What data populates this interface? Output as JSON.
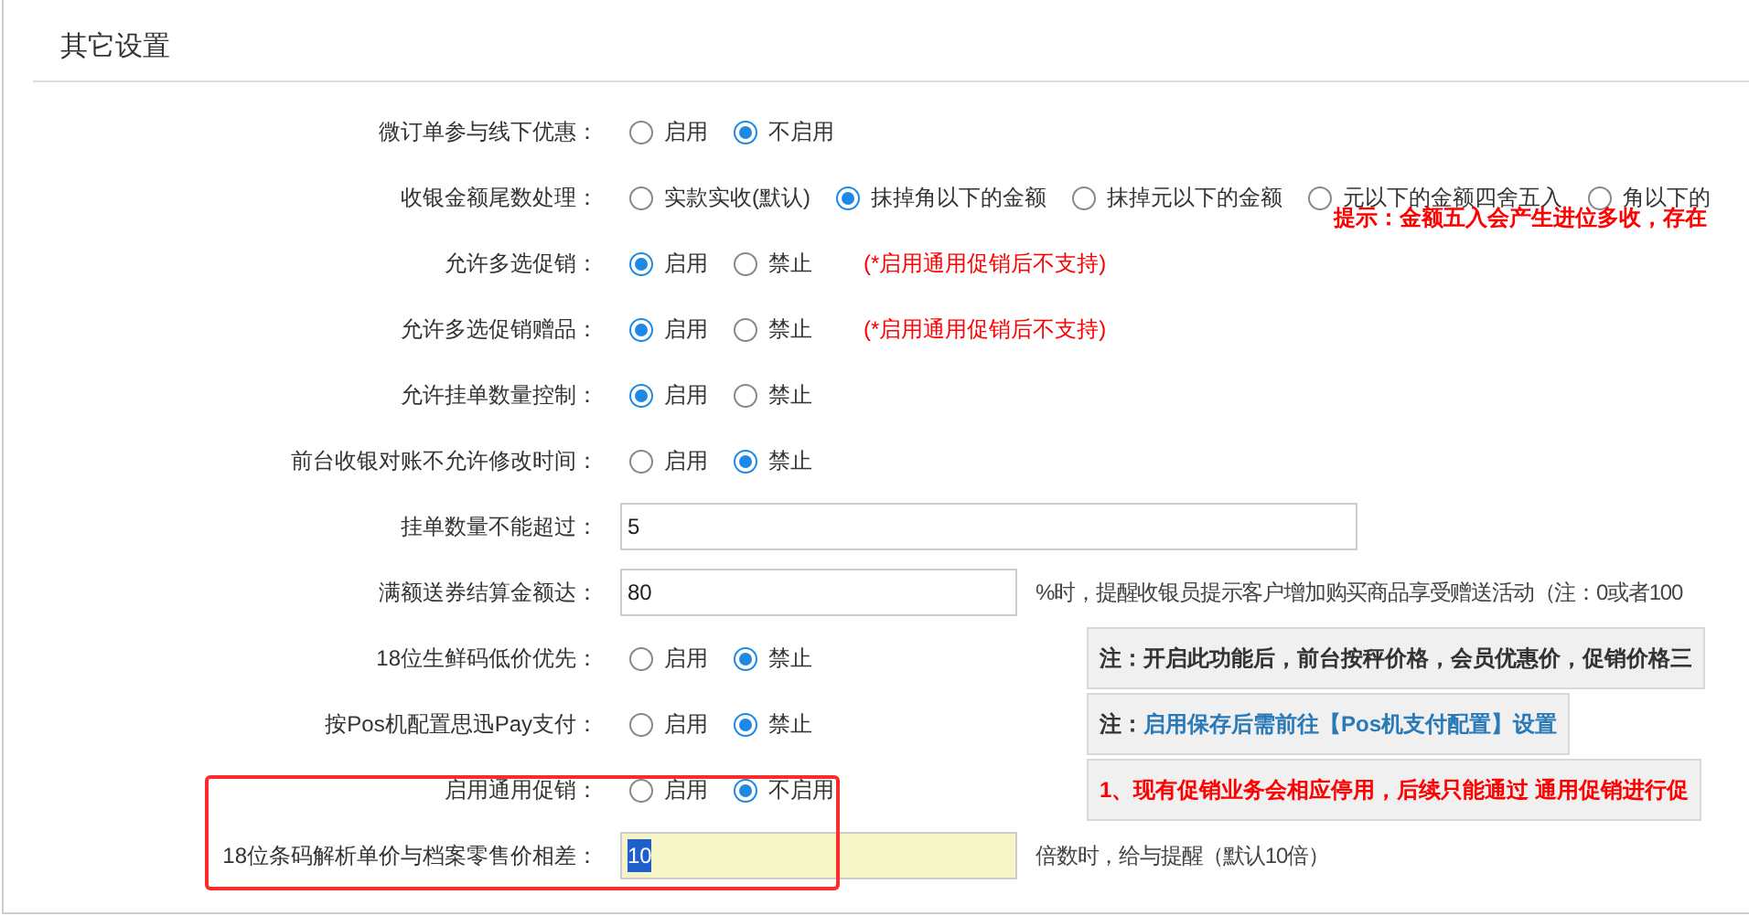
{
  "section": {
    "title": "其它设置"
  },
  "rows": [
    {
      "label": "微订单参与线下优惠：",
      "kind": "radio",
      "options": [
        {
          "label": "启用",
          "selected": false
        },
        {
          "label": "不启用",
          "selected": true
        }
      ]
    },
    {
      "label": "收银金额尾数处理：",
      "kind": "radio",
      "options": [
        {
          "label": "实款实收(默认)",
          "selected": false
        },
        {
          "label": "抹掉角以下的金额",
          "selected": true
        },
        {
          "label": "抹掉元以下的金额",
          "selected": false
        },
        {
          "label": "元以下的金额四舍五入",
          "selected": false
        },
        {
          "label": "角以下的",
          "selected": false
        }
      ],
      "hint": {
        "kind": "below",
        "text": "提示：金额五入会产生进位多收，存在"
      }
    },
    {
      "label": "允许多选促销：",
      "kind": "radio",
      "options": [
        {
          "label": "启用",
          "selected": true
        },
        {
          "label": "禁止",
          "selected": false
        }
      ],
      "hint": {
        "kind": "inline",
        "text": "(*启用通用促销后不支持)"
      }
    },
    {
      "label": "允许多选促销赠品：",
      "kind": "radio",
      "options": [
        {
          "label": "启用",
          "selected": true
        },
        {
          "label": "禁止",
          "selected": false
        }
      ],
      "hint": {
        "kind": "inline",
        "text": "(*启用通用促销后不支持)"
      }
    },
    {
      "label": "允许挂单数量控制：",
      "kind": "radio",
      "options": [
        {
          "label": "启用",
          "selected": true
        },
        {
          "label": "禁止",
          "selected": false
        }
      ]
    },
    {
      "label": "前台收银对账不允许修改时间：",
      "kind": "radio",
      "options": [
        {
          "label": "启用",
          "selected": false
        },
        {
          "label": "禁止",
          "selected": true
        }
      ]
    },
    {
      "label": "挂单数量不能超过：",
      "kind": "input",
      "value": "5"
    },
    {
      "label": "满额送券结算金额达：",
      "kind": "input",
      "value": "80",
      "suffix": "%时，提醒收银员提示客户增加购买商品享受赠送活动（注：0或者100"
    },
    {
      "label": "18位生鲜码低价优先：",
      "kind": "radio",
      "options": [
        {
          "label": "启用",
          "selected": false
        },
        {
          "label": "禁止",
          "selected": true
        }
      ],
      "note": {
        "kind": "plain",
        "text": "注：开启此功能后，前台按秤价格，会员优惠价，促销价格三"
      }
    },
    {
      "label": "按Pos机配置思迅Pay支付：",
      "kind": "radio",
      "options": [
        {
          "label": "启用",
          "selected": false
        },
        {
          "label": "禁止",
          "selected": true
        }
      ],
      "note": {
        "kind": "link",
        "prefix": "注：",
        "text": "启用保存后需前往【Pos机支付配置】设置"
      }
    },
    {
      "label": "启用通用促销：",
      "kind": "radio",
      "options": [
        {
          "label": "启用",
          "selected": false
        },
        {
          "label": "不启用",
          "selected": true
        }
      ],
      "note": {
        "kind": "warning",
        "text": "1、现有促销业务会相应停用，后续只能通过 通用促销进行促"
      }
    },
    {
      "label": "18位条码解析单价与档案零售价相差：",
      "kind": "input",
      "value": "10",
      "highlighted": true,
      "text_selected": true,
      "suffix": "倍数时，给与提醒（默认10倍）"
    }
  ],
  "annotation": {
    "kind": "frame",
    "color": "#ff2a2a"
  }
}
